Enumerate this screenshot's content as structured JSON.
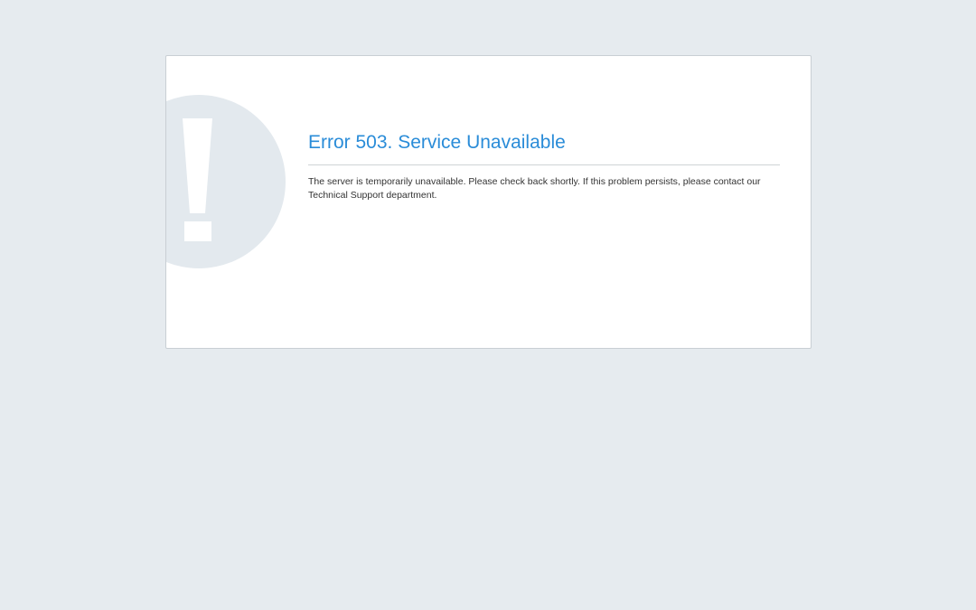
{
  "page": {
    "background_color": "#e6ebef"
  },
  "card": {
    "icon": "exclamation-circle-icon",
    "icon_color": "#e3e9ee",
    "title": "Error 503. Service Unavailable",
    "title_color": "#2a8cd8",
    "message_line_1": "The server is temporarily unavailable. Please check back shortly. If this problem persists, please contact our",
    "message_line_2": "Technical Support department."
  }
}
